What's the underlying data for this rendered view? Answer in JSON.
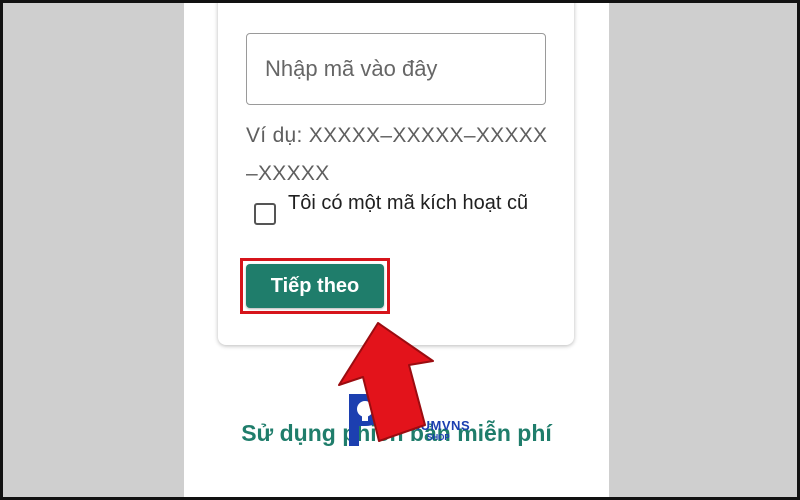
{
  "form": {
    "code_input": {
      "value": "",
      "placeholder": "Nhập mã vào đây"
    },
    "example_text": "Ví dụ: XXXXX–XXXXX–XXXXX –XXXXX",
    "checkbox": {
      "label": "Tôi có một mã kích hoạt cũ",
      "checked": false
    },
    "next_button_label": "Tiếp theo"
  },
  "free_version_link": "Sử dụng phiên bản miễn phí",
  "watermark": {
    "brand": "PREMIUMVNS",
    "sub": "SHOP"
  },
  "colors": {
    "accent": "#1f7d6b",
    "highlight": "#d6141b",
    "arrow": "#e3131b",
    "background": "#cfcfcf",
    "watermark": "#1c3fb0"
  }
}
